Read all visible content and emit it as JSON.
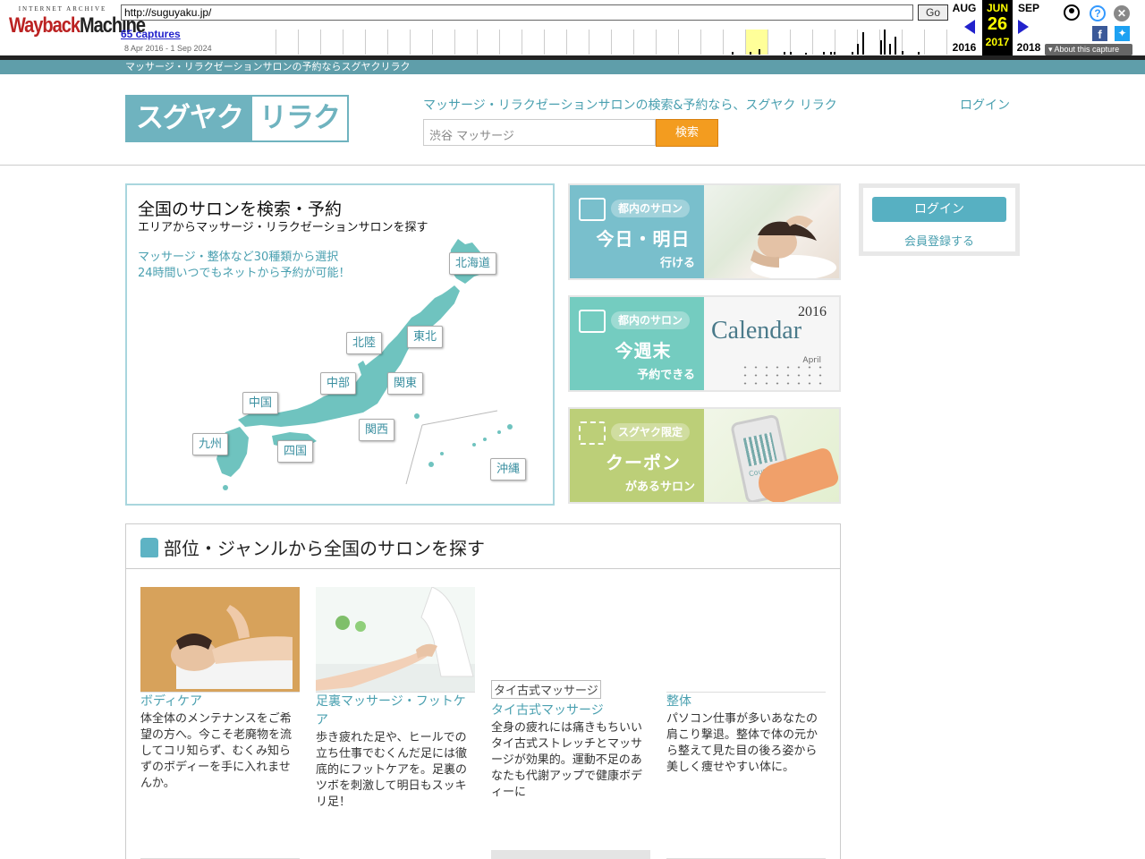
{
  "wayback": {
    "logo_top": "INTERNET ARCHIVE",
    "logo_main_a": "Wayback",
    "logo_main_b": "Machine",
    "url": "http://suguyaku.jp/",
    "go": "Go",
    "captures": "65 captures",
    "range": "8 Apr 2016 - 1 Sep 2024",
    "prev_month": "AUG",
    "cur_month": "JUN",
    "next_month": "SEP",
    "cur_day": "26",
    "prev_year": "2016",
    "cur_year": "2017",
    "next_year": "2018",
    "about": "About this capture",
    "icons": [
      "user-icon",
      "help-icon",
      "close-icon",
      "facebook-icon",
      "twitter-icon"
    ]
  },
  "site": {
    "topbar": "マッサージ・リラクゼーションサロンの予約ならスグヤクリラク",
    "logo_a": "スグヤク",
    "logo_b": "リラク",
    "tagline": "マッサージ・リラクゼーションサロンの検索&予約なら、スグヤク リラク",
    "login": "ログイン",
    "search_placeholder": "渋谷 マッサージ",
    "search_button": "検索"
  },
  "map": {
    "title": "全国のサロンを検索・予約",
    "subtitle": "エリアからマッサージ・リラクゼーションサロンを探す",
    "line1": "マッサージ・整体など30種類から選択",
    "line2": "24時間いつでもネットから予約が可能！",
    "regions": {
      "hokkaido": "北海道",
      "tohoku": "東北",
      "hokuriku": "北陸",
      "chubu": "中部",
      "kanto": "関東",
      "chugoku": "中国",
      "kansai": "関西",
      "kyushu": "九州",
      "shikoku": "四国",
      "okinawa": "沖縄"
    }
  },
  "banners": [
    {
      "pill": "都内のサロン",
      "big": "今日・明日",
      "small": "行ける"
    },
    {
      "pill": "都内のサロン",
      "big": "今週末",
      "small": "予約できる",
      "photo_year": "2016",
      "photo_text": "Calendar",
      "photo_month": "April"
    },
    {
      "pill": "スグヤク限定",
      "big": "クーポン",
      "small": "があるサロン",
      "photo_text": "Coupon"
    }
  ],
  "side": {
    "login": "ログイン",
    "register": "会員登録する"
  },
  "genre": {
    "title": "部位・ジャンルから全国のサロンを探す",
    "cards": [
      {
        "caption": "ボディケア",
        "desc": "体全体のメンテナンスをご希望の方へ。今こそ老廃物を流してコリ知らず、むくみ知らずのボディーを手に入れませんか。"
      },
      {
        "caption": "足裏マッサージ・フットケア",
        "desc": "歩き疲れた足や、ヒールでの立ち仕事でむくんだ足には徹底的にフットケアを。足裏のツボを刺激して明日もスッキリ足！"
      },
      {
        "caption": "タイ古式マッサージ",
        "alt": "タイ古式マッサージ",
        "desc": "全身の疲れには痛きもちいいタイ古式ストレッチとマッサージが効果的。運動不足のあなたも代謝アップで健康ボディーに"
      },
      {
        "caption": "整体",
        "desc": "パソコン仕事が多いあなたの肩こり撃退。整体で体の元から整えて見た目の後ろ姿から美しく痩せやすい体に。"
      }
    ]
  }
}
